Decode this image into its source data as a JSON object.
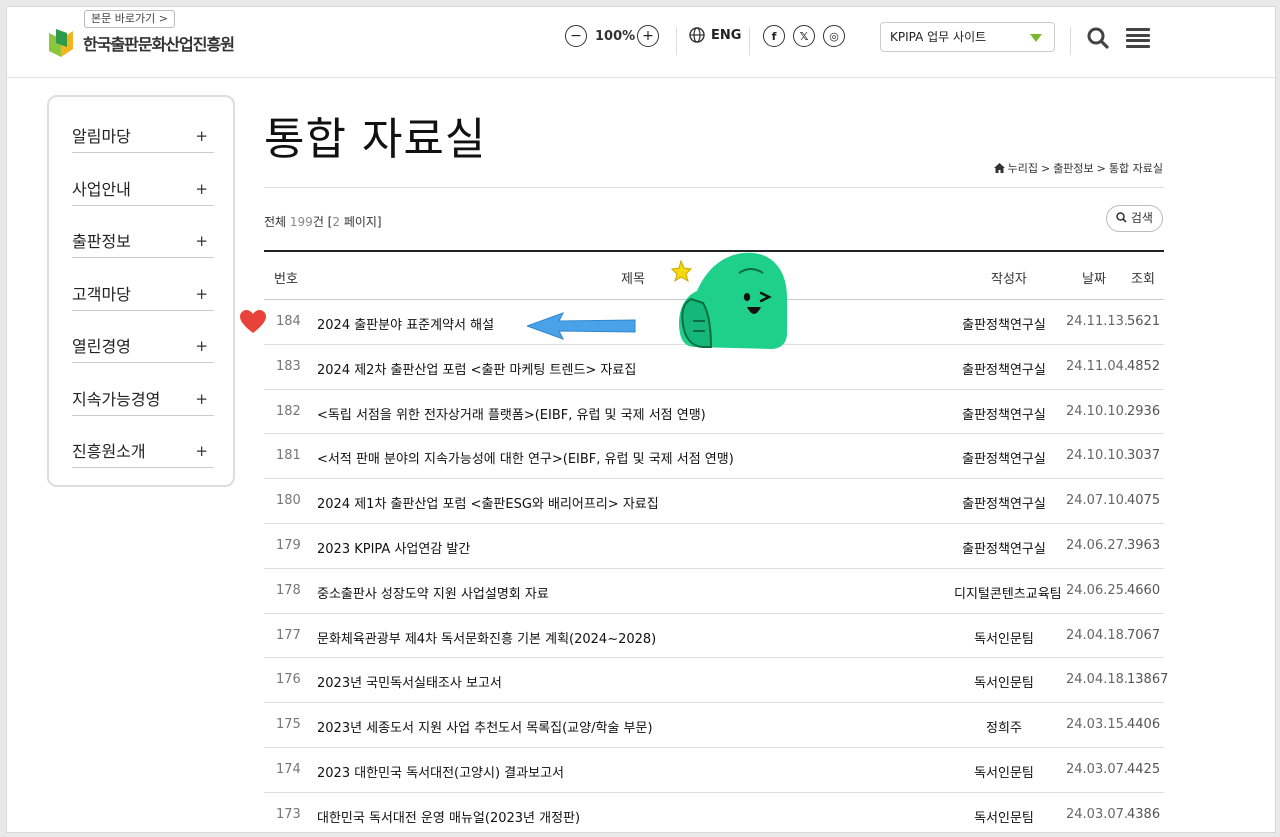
{
  "header": {
    "skip_link": "본문 바로가기 >",
    "logo_text": "한국출판문화산업진흥원",
    "zoom_minus": "−",
    "zoom_level": "100%",
    "zoom_plus": "+",
    "language": "ENG",
    "social": [
      "f",
      "𝕏",
      "◎"
    ],
    "site_select": "KPIPA 업무 사이트",
    "icons": [
      "globe-icon",
      "search-icon",
      "hamburger-menu-icon",
      "facebook-icon",
      "x-icon",
      "instagram-icon"
    ]
  },
  "sidebar": {
    "items": [
      {
        "label": "알림마당",
        "plus": "+"
      },
      {
        "label": "사업안내",
        "plus": "+"
      },
      {
        "label": "출판정보",
        "plus": "+"
      },
      {
        "label": "고객마당",
        "plus": "+"
      },
      {
        "label": "열린경영",
        "plus": "+"
      },
      {
        "label": "지속가능경영",
        "plus": "+"
      },
      {
        "label": "진흥원소개",
        "plus": "+"
      }
    ]
  },
  "main": {
    "title": "통합 자료실",
    "breadcrumb": [
      "누리집",
      ">",
      "출판정보",
      ">",
      "통합 자료실"
    ],
    "total_prefix": "전체 ",
    "total_count": "199",
    "total_suffix": "건 [",
    "total_pages": "2",
    "total_pages_suffix": " 페이지]",
    "search_label": "검색"
  },
  "table": {
    "headers": {
      "num": "번호",
      "title": "제목",
      "author": "작성자",
      "date": "날짜",
      "views": "조회"
    },
    "rows": [
      {
        "num": "184",
        "title": "2024 출판분야 표준계약서 해설",
        "author": "출판정책연구실",
        "date": "24.11.13.",
        "views": "5621"
      },
      {
        "num": "183",
        "title": "2024 제2차 출판산업 포럼 <출판 마케팅 트렌드> 자료집",
        "author": "출판정책연구실",
        "date": "24.11.04.",
        "views": "4852"
      },
      {
        "num": "182",
        "title": "<독립 서점을 위한 전자상거래 플랫폼>(EIBF, 유럽 및 국제 서점 연맹)",
        "author": "출판정책연구실",
        "date": "24.10.10.",
        "views": "2936"
      },
      {
        "num": "181",
        "title": "<서적 판매 분야의 지속가능성에 대한 연구>(EIBF, 유럽 및 국제 서점 연맹)",
        "author": "출판정책연구실",
        "date": "24.10.10.",
        "views": "3037"
      },
      {
        "num": "180",
        "title": "2024 제1차 출판산업 포럼 <출판ESG와 배리어프리> 자료집",
        "author": "출판정책연구실",
        "date": "24.07.10.",
        "views": "4075"
      },
      {
        "num": "179",
        "title": "2023 KPIPA 사업연감 발간",
        "author": "출판정책연구실",
        "date": "24.06.27.",
        "views": "3963"
      },
      {
        "num": "178",
        "title": "중소출판사 성장도약 지원 사업설명회 자료",
        "author": "디지털콘텐츠교육팀",
        "date": "24.06.25.",
        "views": "4660"
      },
      {
        "num": "177",
        "title": "문화체육관광부 제4차 독서문화진흥 기본 계획(2024~2028)",
        "author": "독서인문팀",
        "date": "24.04.18.",
        "views": "7067"
      },
      {
        "num": "176",
        "title": "2023년 국민독서실태조사 보고서",
        "author": "독서인문팀",
        "date": "24.04.18.",
        "views": "13867"
      },
      {
        "num": "175",
        "title": "2023년 세종도서 지원 사업 추천도서 목록집(교양/학술 부문)",
        "author": "정희주",
        "date": "24.03.15.",
        "views": "4406"
      },
      {
        "num": "174",
        "title": "2023 대한민국 독서대전(고양시) 결과보고서",
        "author": "독서인문팀",
        "date": "24.03.07.",
        "views": "4425"
      },
      {
        "num": "173",
        "title": "대한민국 독서대전 운영 매뉴얼(2023년 개정판)",
        "author": "독서인문팀",
        "date": "24.03.07.",
        "views": "4386"
      }
    ]
  },
  "colors": {
    "accent_green": "#7cb82f",
    "mascot_green": "#1ed08a",
    "arrow_blue": "#4aa3e8",
    "heart_red": "#e8433a"
  }
}
